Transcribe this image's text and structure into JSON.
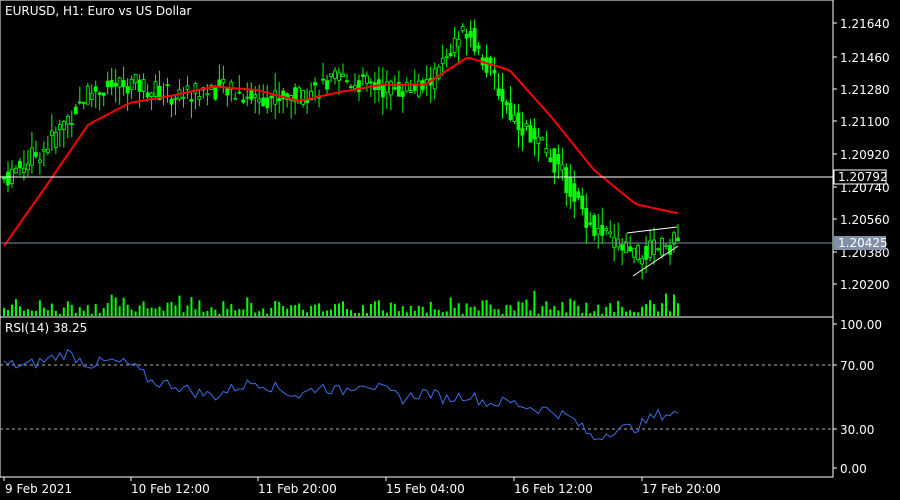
{
  "main_chart": {
    "header": "EURUSD, H1:  Euro vs US Dollar",
    "symbol": "EURUSD",
    "timeframe": "H1",
    "description": "Euro vs US Dollar",
    "price_levels": [
      "1.21640",
      "1.21460",
      "1.21280",
      "1.21100",
      "1.20920",
      "1.20740",
      "1.20560",
      "1.20380",
      "1.20200"
    ],
    "horizontal_line_label": "1.20792",
    "current_price_label": "1.20425",
    "colors": {
      "background": "#000000",
      "candles": "#00ff00",
      "moving_average": "#ff0000",
      "volume": "#00ff00",
      "horizontal_line": "#ffffff",
      "current_price_line": "#8090a8",
      "current_price_badge": "#8090a8"
    }
  },
  "rsi_panel": {
    "header": "RSI(14) 38.25",
    "levels": [
      "100.00",
      "70.00",
      "30.00",
      "0.00"
    ],
    "colors": {
      "line": "#3a6fe8",
      "level_lines": "#b0b0b0"
    }
  },
  "time_axis": {
    "labels": [
      "9 Feb 2021",
      "10 Feb 12:00",
      "11 Feb 20:00",
      "15 Feb 04:00",
      "16 Feb 12:00",
      "17 Feb 20:00"
    ]
  },
  "chart_data": [
    {
      "type": "line",
      "title": "EURUSD, H1:  Euro vs US Dollar",
      "x": [
        "9 Feb 2021",
        "10 Feb 12:00",
        "11 Feb 20:00",
        "15 Feb 04:00",
        "16 Feb 12:00",
        "17 Feb 20:00"
      ],
      "ylim": [
        1.2011,
        1.2172
      ],
      "series": [
        {
          "name": "",
          "values": [
            1.2078,
            1.2096,
            1.2126,
            1.2131,
            1.2124,
            1.2128,
            1.2123,
            1.2124,
            1.2133,
            1.2128,
            1.2128,
            1.2162,
            1.2115,
            1.209,
            1.205,
            1.2035,
            1.2044
          ]
        },
        {
          "name": "",
          "values": [
            1.2041,
            1.2074,
            1.2108,
            1.212,
            1.2124,
            1.2129,
            1.2127,
            1.2121,
            1.2126,
            1.213,
            1.213,
            1.2145,
            1.2138,
            1.2112,
            1.2083,
            1.2064,
            1.2059
          ]
        }
      ]
    },
    {
      "type": "line",
      "title": "RSI(14) 38.25",
      "ylim": [
        0,
        100
      ],
      "series": [
        {
          "name": "",
          "values": [
            72,
            71,
            75,
            80,
            72,
            74,
            72,
            60,
            58,
            53,
            50,
            56,
            60,
            55,
            50,
            57,
            53,
            60,
            54,
            48,
            53,
            48,
            51,
            45,
            46,
            42,
            40,
            34,
            20,
            27,
            28,
            37,
            38.25
          ]
        }
      ]
    }
  ]
}
